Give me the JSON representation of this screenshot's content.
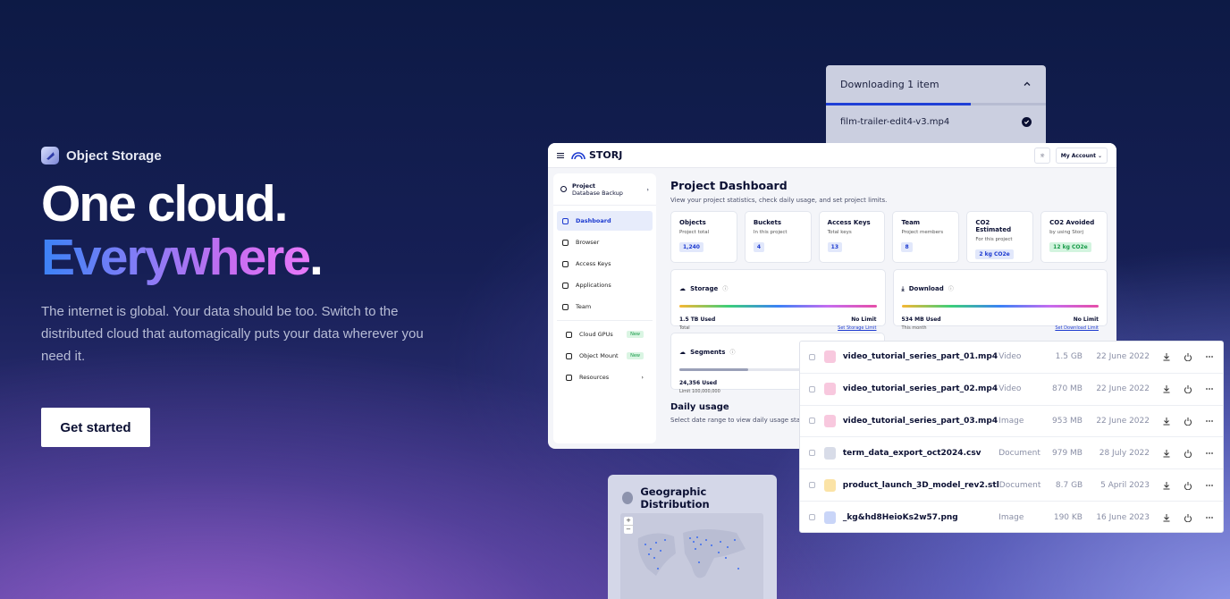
{
  "hero": {
    "badge": "Object Storage",
    "headline_1": "One cloud.",
    "headline_2": "Everywhere",
    "headline_dot": ".",
    "description": "The internet is global. Your data should be too. Switch to the distributed cloud that automagically puts your data wherever you need it.",
    "cta": "Get started"
  },
  "download_panel": {
    "title": "Downloading 1 item",
    "file": "film-trailer-edit4-v3.mp4",
    "progress": 0.66
  },
  "dashboard": {
    "logo": "STORJ",
    "account": "My Account",
    "project_label": "Project",
    "project_name": "Database Backup",
    "nav": [
      "Dashboard",
      "Browser",
      "Access Keys",
      "Applications",
      "Team"
    ],
    "nav2": [
      {
        "label": "Cloud GPUs",
        "tag": "New"
      },
      {
        "label": "Object Mount",
        "tag": "New"
      },
      {
        "label": "Resources",
        "tag": ""
      }
    ],
    "title": "Project Dashboard",
    "subtitle": "View your project statistics, check daily usage, and set project limits.",
    "cards": [
      {
        "title": "Objects",
        "sub": "Project total",
        "value": "1,240"
      },
      {
        "title": "Buckets",
        "sub": "In this project",
        "value": "4"
      },
      {
        "title": "Access Keys",
        "sub": "Total keys",
        "value": "13"
      },
      {
        "title": "Team",
        "sub": "Project members",
        "value": "8"
      },
      {
        "title": "CO2 Estimated",
        "sub": "For this project",
        "value": "2 kg CO2e"
      },
      {
        "title": "CO2 Avoided",
        "sub": "by using Storj",
        "value": "12 kg CO2e"
      }
    ],
    "storage": {
      "title": "Storage",
      "used": "1.5 TB Used",
      "limit": "No Limit",
      "foot": "Total",
      "link": "Set Storage Limit"
    },
    "download": {
      "title": "Download",
      "used": "534 MB Used",
      "limit": "No Limit",
      "foot": "This month",
      "link": "Set Download Limit"
    },
    "segments": {
      "title": "Segments",
      "used": "24,356 Used",
      "foot": "Limit 100,000,000"
    },
    "daily_title": "Daily usage",
    "daily_sub": "Select date range to view daily usage stati"
  },
  "files": [
    {
      "name": "video_tutorial_series_part_01.mp4",
      "type": "Video",
      "size": "1.5 GB",
      "date": "22 June 2022",
      "color": "#f8c8de"
    },
    {
      "name": "video_tutorial_series_part_02.mp4",
      "type": "Video",
      "size": "870 MB",
      "date": "22 June 2022",
      "color": "#f8c8de"
    },
    {
      "name": "video_tutorial_series_part_03.mp4",
      "type": "Image",
      "size": "953 MB",
      "date": "22 June 2022",
      "color": "#f8c8de"
    },
    {
      "name": "term_data_export_oct2024.csv",
      "type": "Document",
      "size": "979 MB",
      "date": "28 July 2022",
      "color": "#d8dce8"
    },
    {
      "name": "product_launch_3D_model_rev2.stl",
      "type": "Document",
      "size": "8.7 GB",
      "date": "5 April 2023",
      "color": "#fbe3a6"
    },
    {
      "name": "_kg&hd8HeioKs2w57.png",
      "type": "Image",
      "size": "190 KB",
      "date": "16 June 2023",
      "color": "#c9d5f8"
    }
  ],
  "geo": {
    "title": "Geographic Distribution",
    "zoom_in": "+",
    "zoom_out": "−"
  }
}
